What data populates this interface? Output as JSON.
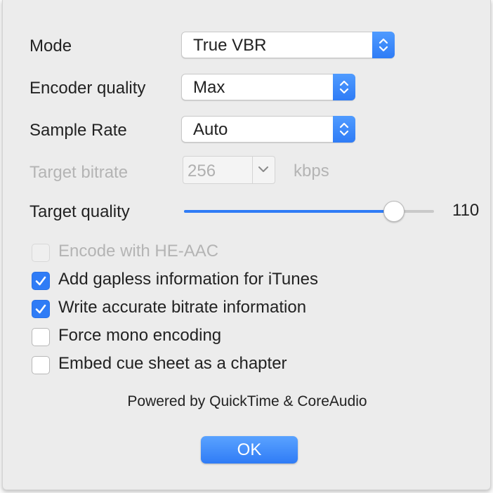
{
  "colors": {
    "accent": "#2f7cf6",
    "disabled_text": "#b4b4b4"
  },
  "mode": {
    "label": "Mode",
    "value": "True VBR"
  },
  "encoder_quality": {
    "label": "Encoder quality",
    "value": "Max"
  },
  "sample_rate": {
    "label": "Sample Rate",
    "value": "Auto"
  },
  "target_bitrate": {
    "label": "Target bitrate",
    "value": "256",
    "unit": "kbps",
    "enabled": false
  },
  "target_quality": {
    "label": "Target quality",
    "value": "110",
    "slider_fraction": 0.84
  },
  "options": [
    {
      "label": "Encode with HE-AAC",
      "checked": false,
      "enabled": false
    },
    {
      "label": "Add gapless information for iTunes",
      "checked": true,
      "enabled": true
    },
    {
      "label": "Write accurate bitrate information",
      "checked": true,
      "enabled": true
    },
    {
      "label": "Force mono encoding",
      "checked": false,
      "enabled": true
    },
    {
      "label": "Embed cue sheet as a chapter",
      "checked": false,
      "enabled": true
    }
  ],
  "footer": {
    "text": "Powered by QuickTime & CoreAudio"
  },
  "ok_button": {
    "label": "OK"
  }
}
